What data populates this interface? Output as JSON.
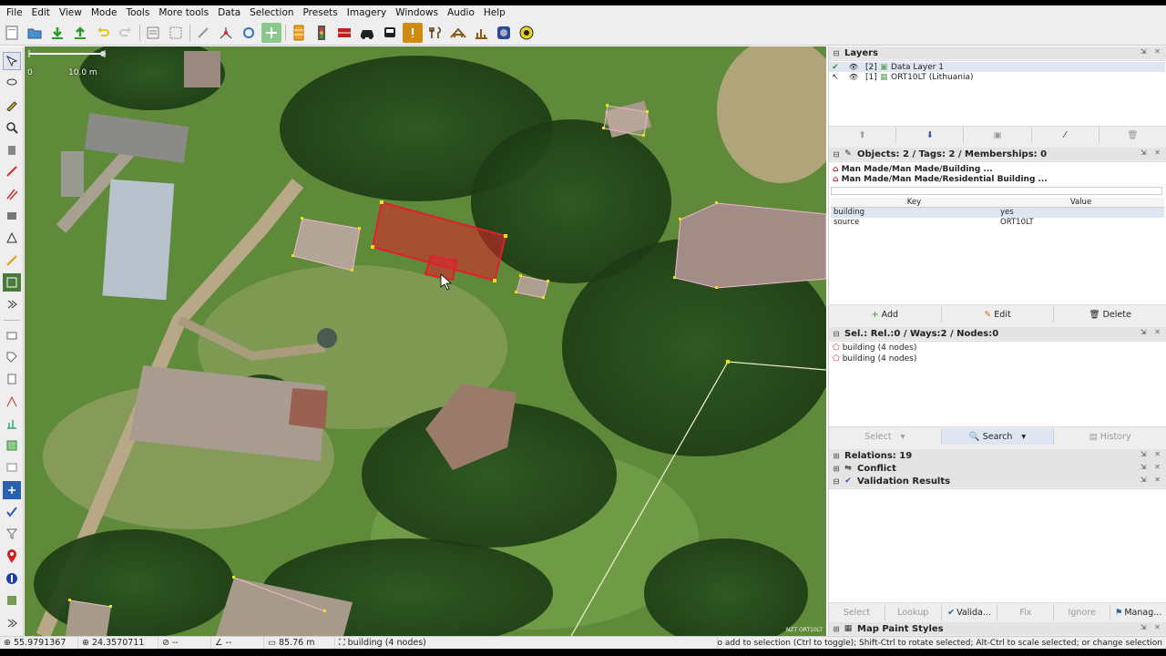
{
  "menu": [
    "File",
    "Edit",
    "View",
    "Mode",
    "Tools",
    "More tools",
    "Data",
    "Selection",
    "Presets",
    "Imagery",
    "Windows",
    "Audio",
    "Help"
  ],
  "toolbar_icons": [
    "new-file-icon",
    "open-file-icon",
    "download-icon",
    "upload-icon",
    "undo-icon",
    "redo-icon",
    "preferences-icon",
    "zoom-fit-icon",
    "delete-icon",
    "split-icon",
    "refresh-icon",
    "imagery-icon",
    "barrier-icon",
    "traffic-light-icon",
    "fence-icon",
    "car-icon",
    "bus-icon",
    "hazard-icon",
    "restaurant-icon",
    "building-icon",
    "chart-icon",
    "camera-icon",
    "sun-icon"
  ],
  "left_tools": [
    "select-tool-icon",
    "lasso-icon",
    "draw-icon",
    "zoom-icon",
    "delete-tool-icon",
    "improve-way-icon",
    "parallel-icon",
    "extrude-icon",
    "building-tool-icon",
    "draw-way-icon",
    "map-icon",
    "more-arrow-icon"
  ],
  "left_tools_bottom": [
    "layers-toggle-icon",
    "tags-toggle-icon",
    "filter-icon",
    "relations-icon",
    "validation-icon",
    "history-icon",
    "image-icon",
    "location-icon",
    "user-icon",
    "move-icon",
    "checkmark-icon",
    "funnel-icon",
    "marker-icon",
    "compass-icon",
    "settings-icon",
    "expand-icon"
  ],
  "map": {
    "scale_label": "10.0 m",
    "scale_zero": "0",
    "attribution": "NZT ORT10LT"
  },
  "layers": {
    "title": "Layers",
    "rows": [
      {
        "index": "[2]",
        "name": "Data Layer 1",
        "selected": true
      },
      {
        "index": "[1]",
        "name": "ORT10LT (Lithuania)",
        "selected": false
      }
    ]
  },
  "tags_panel": {
    "title": "Objects: 2 / Tags: 2 / Memberships: 0",
    "presets": [
      "Man Made/Man Made/Building ...",
      "Man Made/Man Made/Residential Building ..."
    ],
    "header_key": "Key",
    "header_value": "Value",
    "rows": [
      {
        "key": "building",
        "value": "yes"
      },
      {
        "key": "source",
        "value": "ORT10LT"
      }
    ],
    "buttons": {
      "add": "Add",
      "edit": "Edit",
      "delete": "Delete"
    }
  },
  "selection_panel": {
    "title": "Sel.: Rel.:0 / Ways:2 / Nodes:0",
    "items": [
      "building (4 nodes)",
      "building (4 nodes)"
    ],
    "buttons": {
      "select": "Select",
      "search": "Search",
      "history": "History"
    }
  },
  "collapsed_panels": {
    "relations": "Relations: 19",
    "conflict": "Conflict",
    "validation": "Validation Results"
  },
  "validation_buttons": {
    "select": "Select",
    "lookup": "Lookup",
    "validate": "Valida...",
    "fix": "Fix",
    "ignore": "Ignore",
    "manage": "Manag..."
  },
  "map_paint": "Map Paint Styles",
  "status": {
    "lat": "55.9791367",
    "lon": "24.3570711",
    "heading": "--",
    "angle": "--",
    "distance": "85.76 m",
    "selection": "building (4 nodes)",
    "hint": "g: Shift to add to selection (Ctrl to toggle); Shift-Ctrl to rotate selected; Alt-Ctrl to scale selected; or change selection"
  },
  "colors": {
    "selection": "#e0202a",
    "node": "#f0e010",
    "map_bg": "#4f7a30",
    "panel_selected": "#dfe6f2"
  }
}
